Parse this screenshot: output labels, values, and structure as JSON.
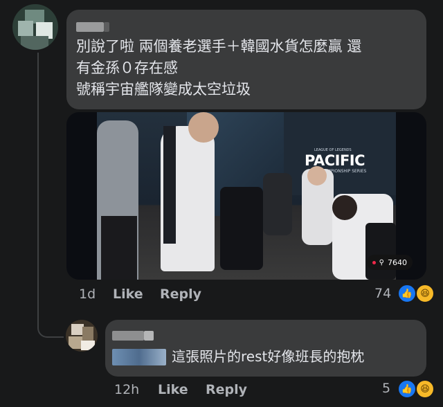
{
  "comment_main": {
    "text_lines": [
      "別說了啦 兩個養老選手＋韓國水貨怎麼贏 還",
      "有金孫０存在感",
      "號稱宇宙艦隊變成太空垃圾"
    ],
    "photo": {
      "sign_text": "PACIFIC",
      "sign_subtext": "CHAMPIONSHIP SERIES",
      "sign_toptext": "LEAGUE OF LEGENDS",
      "views": "7640"
    },
    "time": "1d",
    "like_label": "Like",
    "reply_label": "Reply",
    "reaction_count": "74",
    "reactions": [
      "like-icon",
      "haha-icon"
    ]
  },
  "reply": {
    "text": "這張照片的rest好像班長的抱枕",
    "time": "12h",
    "like_label": "Like",
    "reply_label": "Reply",
    "reaction_count": "5",
    "reactions": [
      "like-icon",
      "haha-icon"
    ]
  },
  "colors": {
    "background": "#18191a",
    "bubble": "#3a3b3c",
    "text": "#e4e6eb",
    "muted": "#b0b3b8",
    "like_blue": "#1877f2",
    "haha_yellow": "#f7b928"
  }
}
